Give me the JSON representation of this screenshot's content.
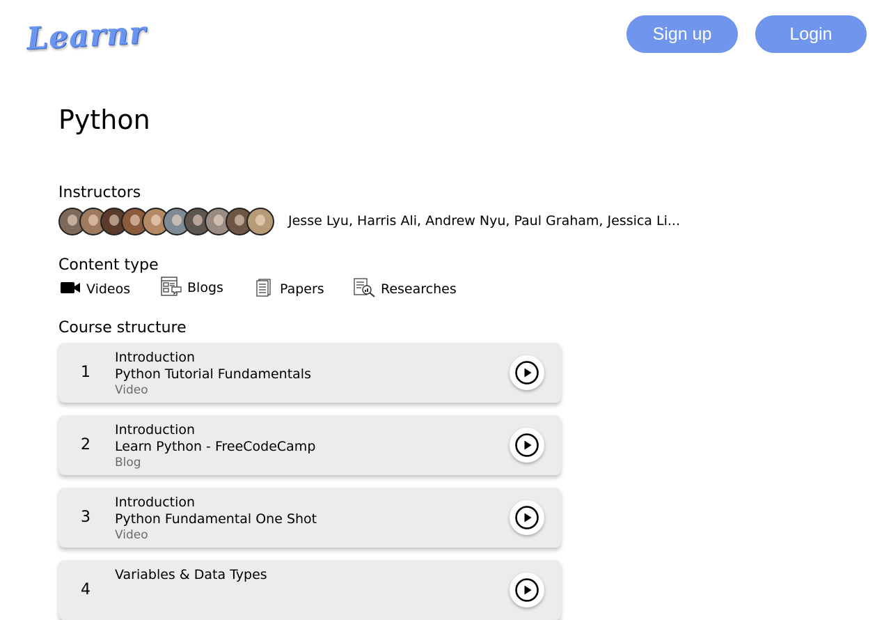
{
  "header": {
    "logo": "Learnr",
    "signup_label": "Sign up",
    "login_label": "Login"
  },
  "course": {
    "title": "Python"
  },
  "instructors": {
    "label": "Instructors",
    "names": "Jesse Lyu, Harris Ali, Andrew Nyu, Paul Graham, Jessica Li...",
    "avatar_count": 10
  },
  "content_type": {
    "label": "Content type",
    "items": [
      {
        "label": "Videos",
        "icon": "video-camera-icon"
      },
      {
        "label": "Blogs",
        "icon": "blog-icon"
      },
      {
        "label": "Papers",
        "icon": "document-icon"
      },
      {
        "label": "Researches",
        "icon": "research-icon"
      }
    ]
  },
  "course_structure": {
    "label": "Course structure",
    "items": [
      {
        "number": "1",
        "section": "Introduction",
        "title": "Python Tutorial Fundamentals",
        "type": "Video"
      },
      {
        "number": "2",
        "section": "Introduction",
        "title": "Learn Python - FreeCodeCamp",
        "type": "Blog"
      },
      {
        "number": "3",
        "section": "Introduction",
        "title": "Python Fundamental One Shot",
        "type": "Video"
      },
      {
        "number": "4",
        "section": "Variables & Data Types",
        "title": "",
        "type": ""
      }
    ]
  },
  "colors": {
    "accent": "#6f95ec",
    "card_bg": "#ececec",
    "muted_text": "#6b6b6b"
  }
}
